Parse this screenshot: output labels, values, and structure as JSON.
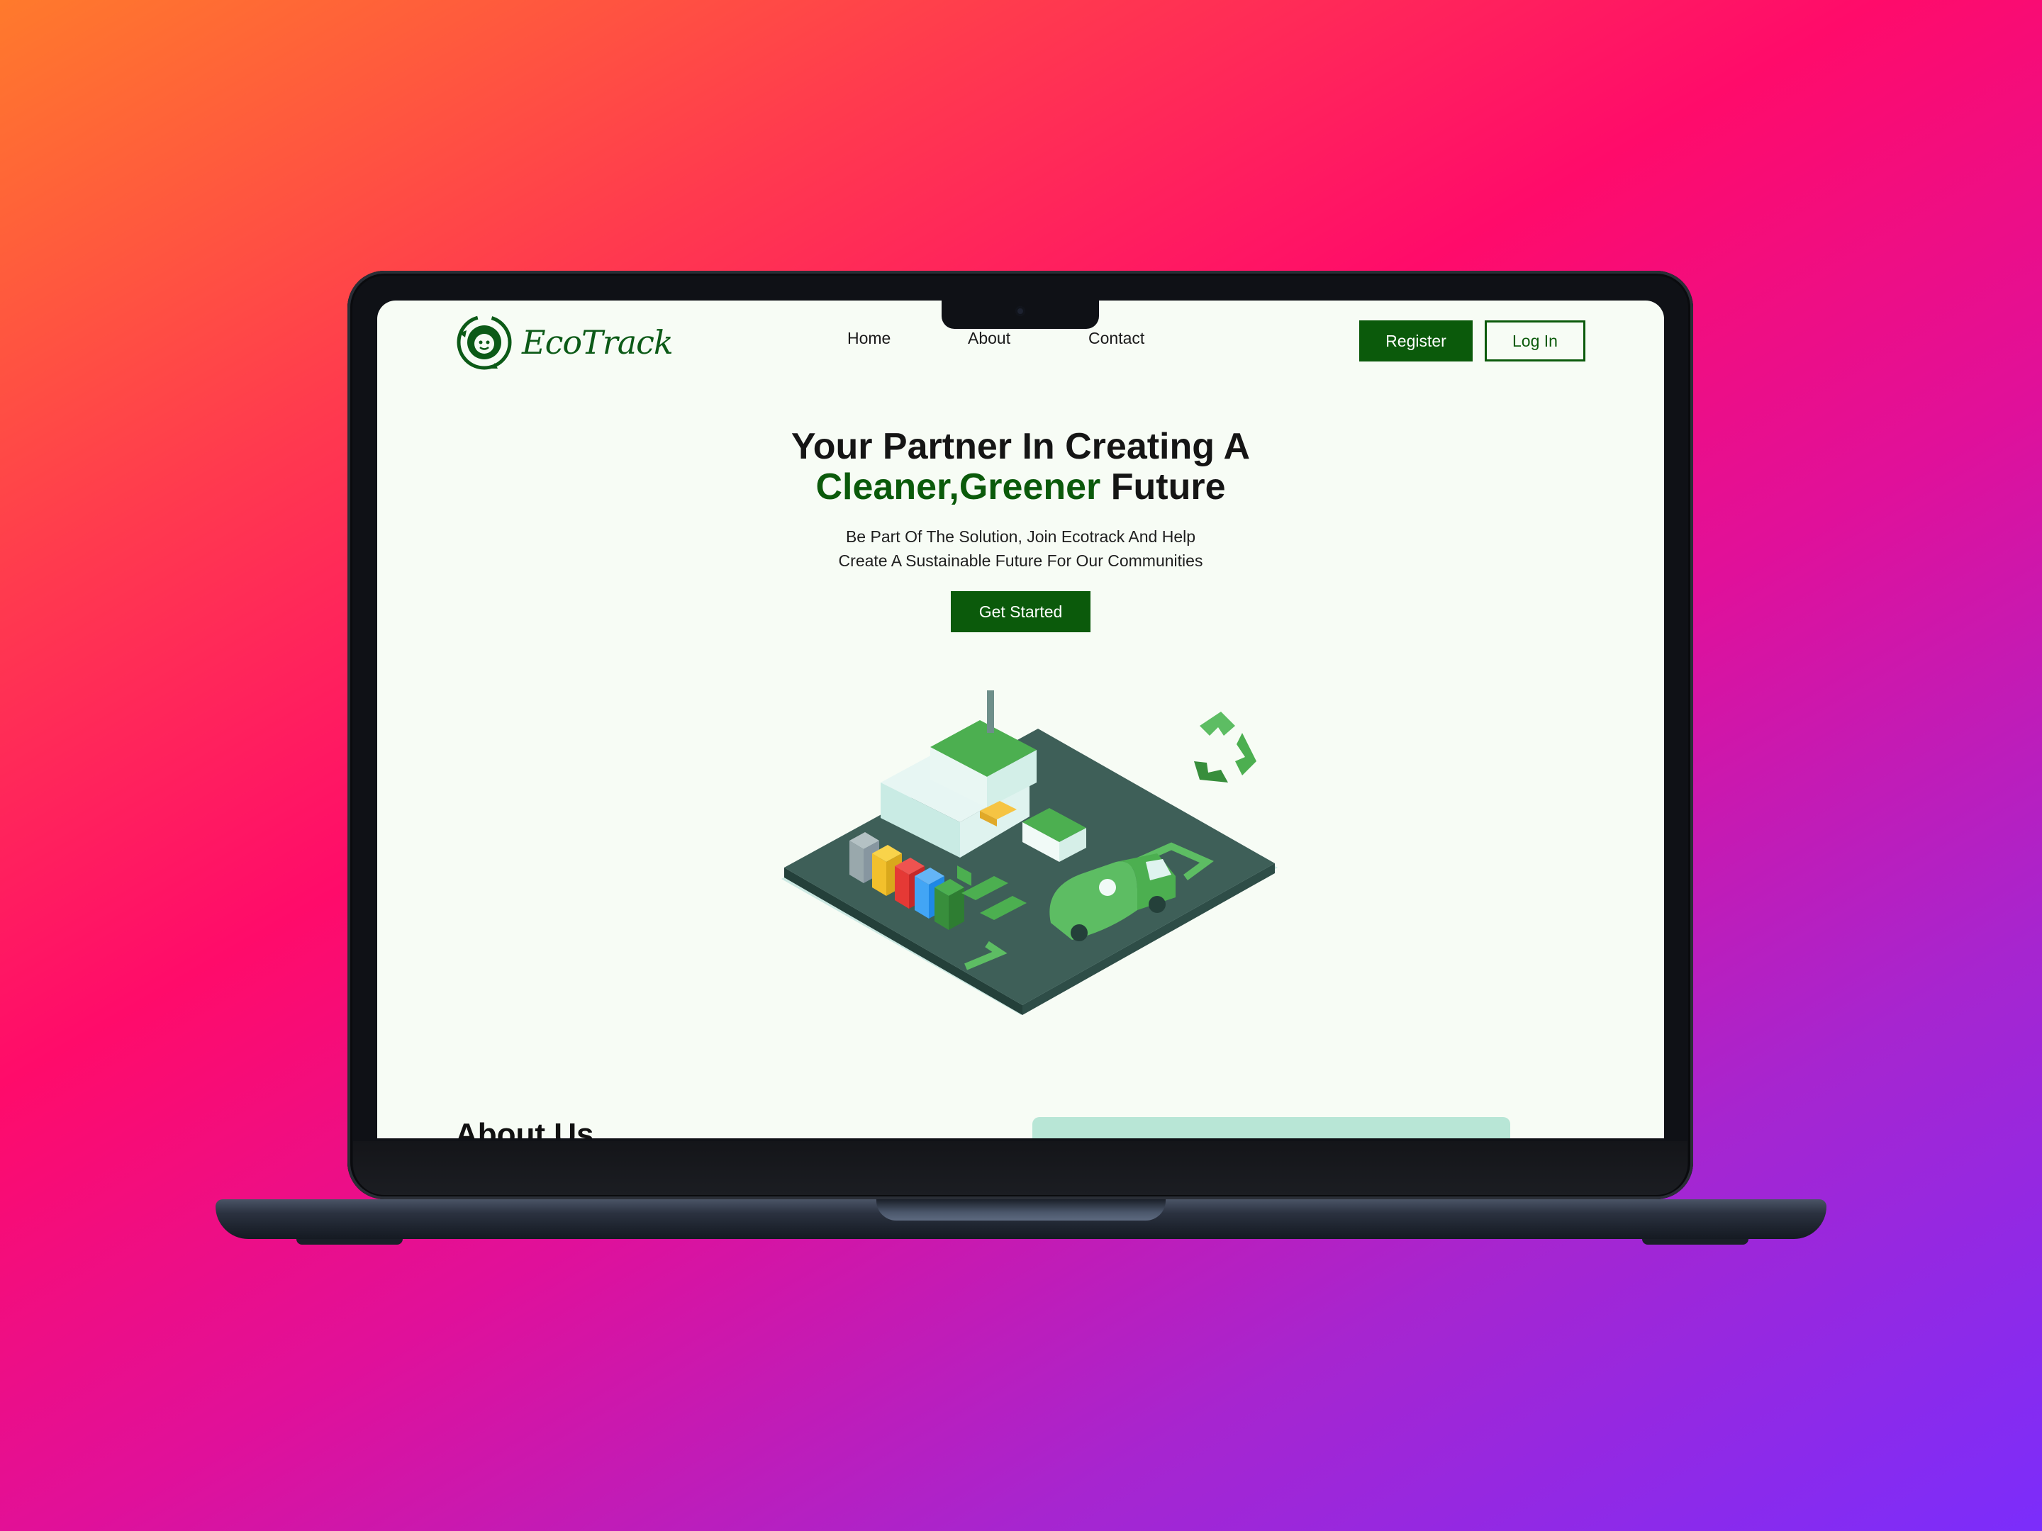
{
  "site": {
    "brand": "EcoTrack",
    "nav": {
      "home": "Home",
      "about": "About",
      "contact": "Contact"
    },
    "buttons": {
      "register": "Register",
      "login": "Log In",
      "get_started": "Get Started"
    },
    "hero": {
      "title_line1": "Your Partner In Creating A",
      "title_highlight": "Cleaner,Greener",
      "title_rest": " Future",
      "subtitle_line1": "Be Part Of The Solution, Join Ecotrack And Help",
      "subtitle_line2": "Create A Sustainable Future For Our Communities"
    },
    "about": {
      "title": "About Us"
    },
    "colors": {
      "primary": "#0b5a0b",
      "background": "#f7fcf5",
      "accent": "#b8e6d6"
    }
  },
  "icons": {
    "logo": "recycle-earth-icon",
    "illustration": "recycling-plant-illustration"
  }
}
